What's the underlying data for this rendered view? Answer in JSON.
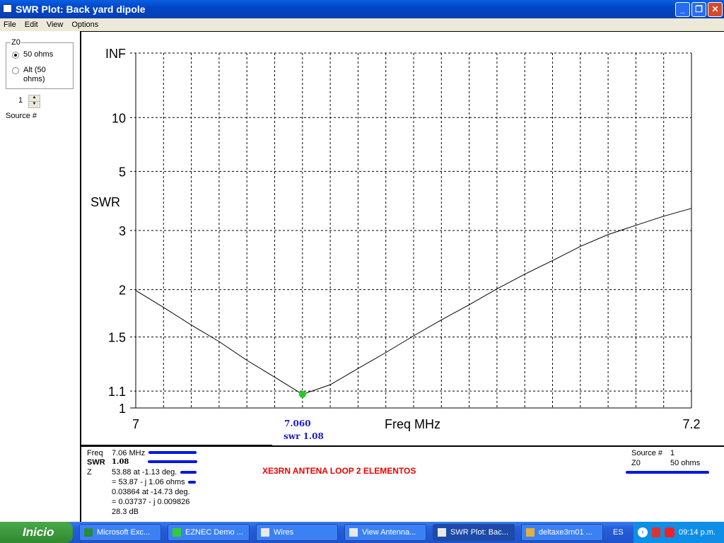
{
  "window": {
    "title": "SWR Plot: Back yard dipole"
  },
  "menu": [
    "File",
    "Edit",
    "View",
    "Options"
  ],
  "left": {
    "z0_group": "Z0",
    "opt1": "50 ohms",
    "opt2": "Alt (50 ohms)",
    "source_value": "1",
    "source_label": "Source #"
  },
  "plot": {
    "ylabel": "SWR",
    "xlabel": "Freq MHz",
    "cursor_freq": "7.060",
    "cursor_swr": "swr 1.08"
  },
  "info": {
    "freq_label": "Freq",
    "freq_value": "7.06 MHz",
    "swr_label": "SWR",
    "swr_value": "1.08",
    "z_label": "Z",
    "z1": "53.88 at -1.13 deg.",
    "z2": "= 53.87 - j 1.06 ohms",
    "r1": "0.03864 at -14.73 deg.",
    "r2": "= 0.03737 - j 0.009826",
    "rl": "28.3 dB",
    "title": "XE3RN ANTENA LOOP 2 ELEMENTOS",
    "source_label": "Source #",
    "source_value": "1",
    "z0_label": "Z0",
    "z0_value": "50 ohms"
  },
  "chart_data": {
    "type": "line",
    "title": "SWR Plot",
    "xlabel": "Freq MHz",
    "ylabel": "SWR",
    "xlim": [
      7.0,
      7.2
    ],
    "x_ticks": [
      "7",
      "7.2"
    ],
    "y_ticks": [
      {
        "v": 1,
        "label": "1"
      },
      {
        "v": 1.1,
        "label": "1.1"
      },
      {
        "v": 1.5,
        "label": "1.5"
      },
      {
        "v": 2,
        "label": "2"
      },
      {
        "v": 3,
        "label": "3"
      },
      {
        "v": 5,
        "label": "5"
      },
      {
        "v": 10,
        "label": "10"
      },
      {
        "v": "inf",
        "label": "INF"
      }
    ],
    "y_scale": "reflection-coefficient",
    "grid": true,
    "x": [
      7.0,
      7.01,
      7.02,
      7.03,
      7.04,
      7.05,
      7.06,
      7.07,
      7.08,
      7.09,
      7.1,
      7.11,
      7.12,
      7.13,
      7.14,
      7.15,
      7.16,
      7.17,
      7.18,
      7.19,
      7.2
    ],
    "y": [
      1.99,
      1.79,
      1.61,
      1.46,
      1.31,
      1.19,
      1.08,
      1.14,
      1.25,
      1.37,
      1.51,
      1.66,
      1.82,
      2.01,
      2.21,
      2.42,
      2.67,
      2.91,
      3.12,
      3.35,
      3.57
    ],
    "marker": {
      "x": 7.06,
      "y": 1.08,
      "color": "#22cc22"
    },
    "line_color": "#000000"
  },
  "taskbar": {
    "start": "Inicio",
    "tasks": [
      "Microsoft Exc...",
      "EZNEC Demo ...",
      "Wires",
      "View Antenna...",
      "SWR Plot: Bac...",
      "deltaxe3rn01 ..."
    ],
    "lang": "ES",
    "time": "09:14 p.m."
  },
  "colors": {
    "accent": "#0018e0",
    "title_red": "#ee0000",
    "cursor_blue": "#1a1ad0"
  }
}
